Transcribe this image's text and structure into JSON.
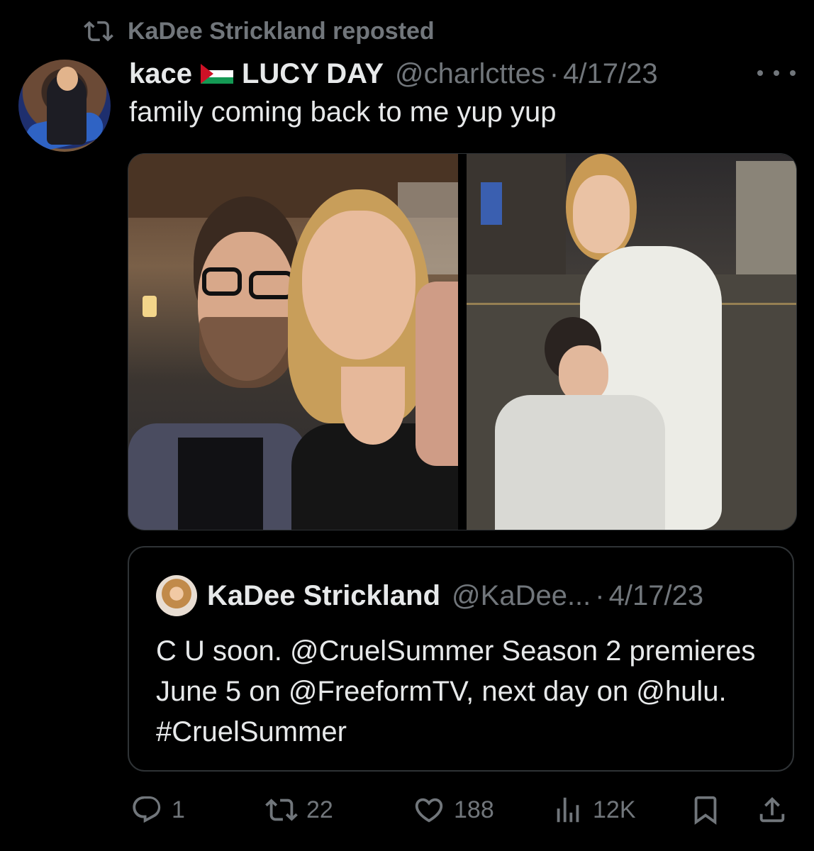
{
  "repost": {
    "label": "KaDee Strickland reposted",
    "icon": "repost-icon"
  },
  "tweet": {
    "author_name": "kace",
    "flag": "palestine-flag-emoji",
    "author_name_suffix": "LUCY DAY",
    "handle": "@charlcttes",
    "separator": "·",
    "date": "4/17/23",
    "text": "family coming back to me yup yup",
    "media_count": 2
  },
  "quote": {
    "author_name": "KaDee Strickland",
    "handle": "@KaDee...",
    "separator": "·",
    "date": "4/17/23",
    "text": "C U soon. @CruelSummer Season 2 premieres June 5 on @FreeformTV, next day on @hulu. #CruelSummer"
  },
  "actions": {
    "replies": "1",
    "reposts": "22",
    "likes": "188",
    "views": "12K"
  },
  "colors": {
    "background": "#000000",
    "text": "#e7e9ea",
    "muted": "#71767b",
    "border": "#2f3336"
  }
}
